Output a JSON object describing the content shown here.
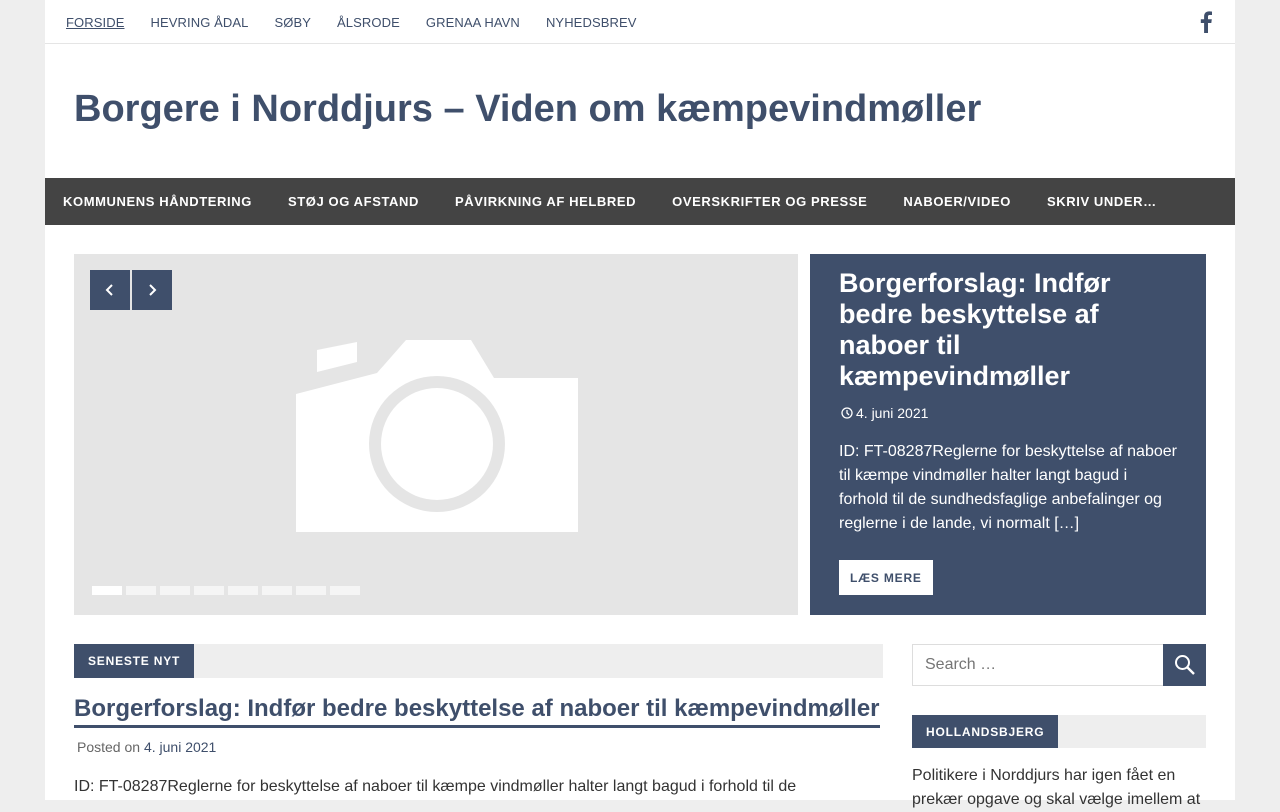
{
  "topnav": {
    "items": [
      "Forside",
      "Hevring Ådal",
      "Søby",
      "Ålsrode",
      "Grenaa Havn",
      "Nyhedsbrev"
    ],
    "active_index": 0,
    "social_icon": "facebook-icon"
  },
  "site": {
    "title": "Borgere i Norddjurs – Viden om kæmpevindmøller"
  },
  "mainnav": {
    "items": [
      "Kommunens håndtering",
      "Støj og afstand",
      "Påvirkning af helbred",
      "Overskrifter og presse",
      "Naboer/video",
      "Skriv under…"
    ]
  },
  "slider": {
    "prev_icon": "chevron-left-icon",
    "next_icon": "chevron-right-icon",
    "image_icon": "camera-placeholder-icon",
    "slide_count": 8,
    "active_slide": 0,
    "title": "Borgerforslag: Indfør bedre beskyttelse af naboer til kæmpevindmøller",
    "date": "4. juni 2021",
    "excerpt": "ID: FT-08287Reglerne for beskyttelse af naboer til kæmpe vindmøller halter langt bagud i forhold til de sundhedsfaglige anbefalinger og reglerne i de lande, vi normalt […]",
    "read_more": "Læs mere"
  },
  "latest": {
    "label": "Seneste nyt",
    "post_title": "Borgerforslag: Indfør bedre beskyttelse af naboer til kæmpevindmøller",
    "posted_on": "Posted on",
    "date": "4. juni 2021",
    "excerpt": "ID: FT-08287Reglerne for beskyttelse af naboer til kæmpe vindmøller halter langt bagud i forhold til de"
  },
  "sidebar": {
    "search_placeholder": "Search …",
    "search_icon": "search-icon",
    "widget_label": "Hollandsbjerg",
    "widget_text": "Politikere i Norddjurs har igen fået en prekær opgave og skal vælge imellem at"
  },
  "colors": {
    "primary": "#3f4f6b",
    "nav_bg": "#444444",
    "page_bg": "#eeeeee"
  }
}
